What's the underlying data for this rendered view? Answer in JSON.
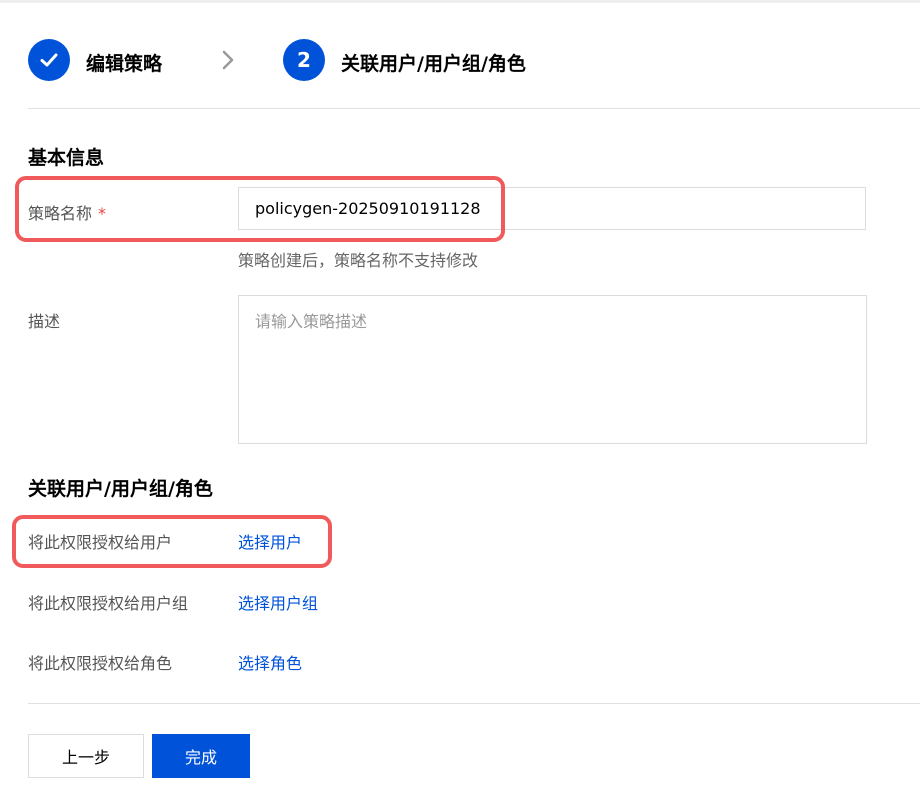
{
  "stepper": {
    "step1": {
      "label": "编辑策略",
      "state": "completed",
      "icon": "check-icon"
    },
    "step2": {
      "number": "2",
      "label": "关联用户/用户组/角色",
      "state": "active"
    },
    "separator_icon": "chevron-right-icon"
  },
  "basic_info": {
    "title": "基本信息",
    "policy_name": {
      "label": "策略名称",
      "required_mark": "*",
      "value": "policygen-20250910191128",
      "help": "策略创建后，策略名称不支持修改"
    },
    "description": {
      "label": "描述",
      "placeholder": "请输入策略描述"
    }
  },
  "associate": {
    "title": "关联用户/用户组/角色",
    "rows": [
      {
        "label": "将此权限授权给用户",
        "link": "选择用户"
      },
      {
        "label": "将此权限授权给用户组",
        "link": "选择用户组"
      },
      {
        "label": "将此权限授权给角色",
        "link": "选择角色"
      }
    ]
  },
  "actions": {
    "prev_label": "上一步",
    "done_label": "完成"
  },
  "colors": {
    "primary": "#0052d9",
    "highlight": "#f05a5a",
    "required": "#e54545"
  }
}
